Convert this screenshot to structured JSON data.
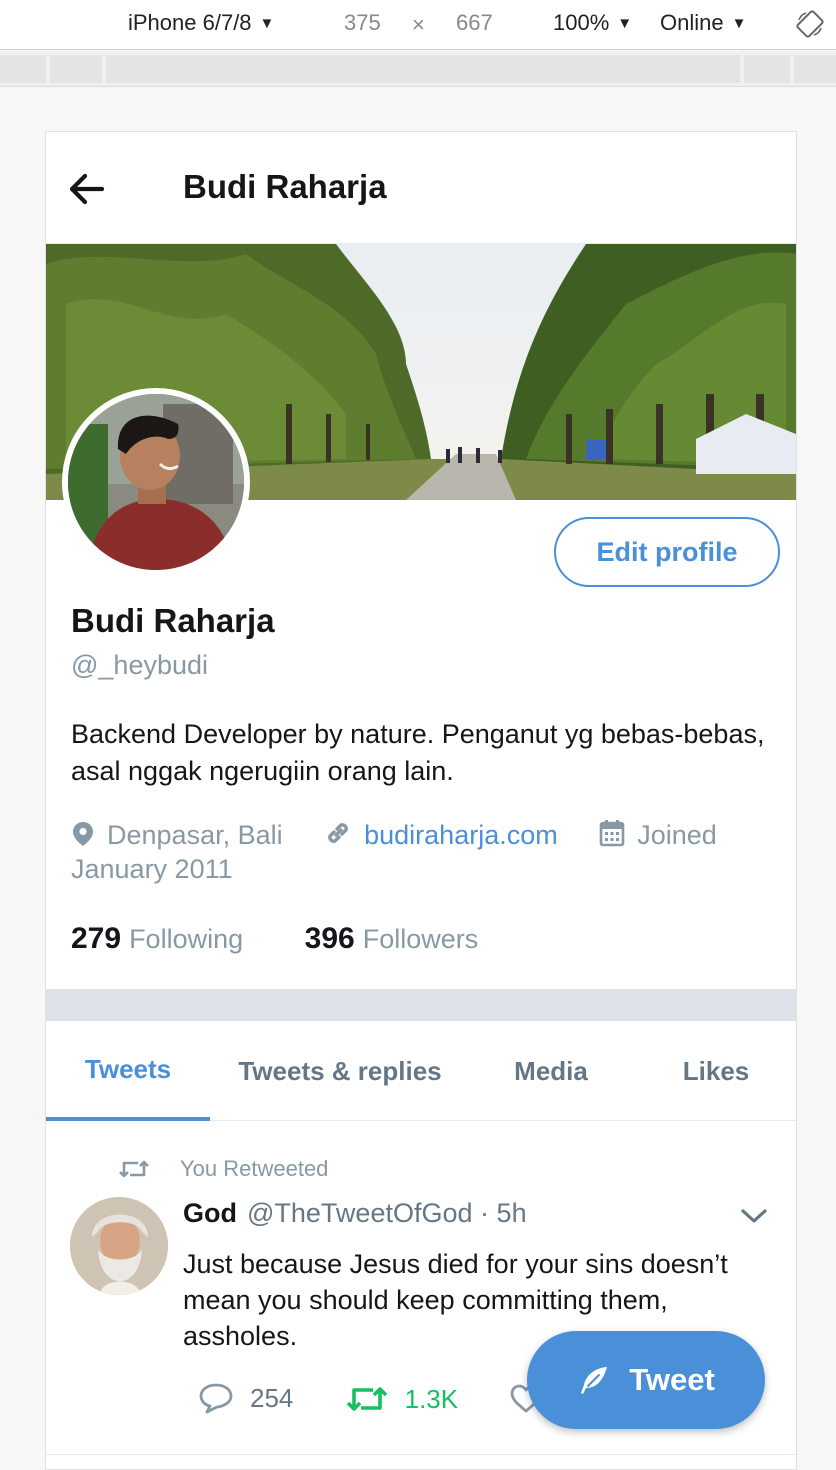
{
  "devtools": {
    "device": "iPhone 6/7/8",
    "width": "375",
    "times": "×",
    "height": "667",
    "zoom": "100%",
    "network": "Online",
    "caret": "▼"
  },
  "header": {
    "title": "Budi Raharja"
  },
  "profile": {
    "edit_label": "Edit profile",
    "name": "Budi Raharja",
    "handle": "@_heybudi",
    "bio": "Backend Developer by nature. Penganut yg bebas-bebas, asal nggak ngerugiin orang lain.",
    "location": "Denpasar, Bali",
    "website": "budiraharja.com",
    "joined": "Joined January 2011",
    "following_count": "279",
    "following_label": "Following",
    "followers_count": "396",
    "followers_label": "Followers"
  },
  "tabs": [
    {
      "label": "Tweets",
      "active": true
    },
    {
      "label": "Tweets & replies"
    },
    {
      "label": "Media"
    },
    {
      "label": "Likes"
    }
  ],
  "tweet": {
    "retweet_note": "You Retweeted",
    "author": "God",
    "author_handle": "@TheTweetOfGod",
    "separator": "·",
    "time": "5h",
    "text": "Just because Jesus died for your sins doesn’t mean you should keep committing them, assholes.",
    "replies": "254",
    "retweets": "1.3K"
  },
  "fab": {
    "label": "Tweet"
  },
  "colors": {
    "accent": "#4a90d9",
    "muted": "#8899a6",
    "retweet_green": "#17bf63",
    "text": "#14171a"
  },
  "icons": [
    "back-arrow-icon",
    "location-pin-icon",
    "link-icon",
    "calendar-icon",
    "retweet-icon",
    "chevron-down-icon",
    "reply-icon",
    "like-icon",
    "feather-icon",
    "rotate-icon"
  ]
}
